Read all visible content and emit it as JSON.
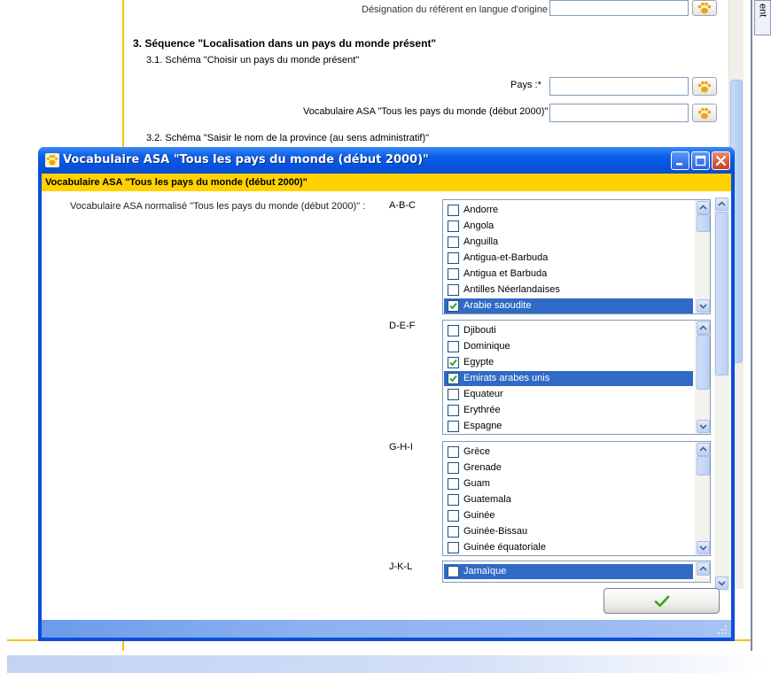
{
  "background_form": {
    "top_label": "Désignation du référent en langue d'origine :",
    "section_title": "3. Séquence \"Localisation dans un pays du monde présent\"",
    "schema_1": "3.1. Schéma \"Choisir un pays du monde présent\"",
    "pays_label": "Pays :*",
    "vocab_label": "Vocabulaire ASA \"Tous les pays du monde (début 2000)\" :*",
    "schema_2": "3.2. Schéma \"Saisir le nom de la province (au sens administratif)\"",
    "side_tab_label": "ent"
  },
  "dialog": {
    "title": "Vocabulaire ASA \"Tous les pays du monde (début 2000)\"",
    "banner": "Vocabulaire ASA \"Tous les pays du monde (début 2000)\"",
    "field_label": "Vocabulaire ASA normalisé \"Tous les pays du monde (début 2000)\" :",
    "groups": [
      {
        "label": "A-B-C",
        "items": [
          {
            "label": "Andorre",
            "checked": false,
            "selected": false
          },
          {
            "label": "Angola",
            "checked": false,
            "selected": false
          },
          {
            "label": "Anguilla",
            "checked": false,
            "selected": false
          },
          {
            "label": "Antigua-et-Barbuda",
            "checked": false,
            "selected": false
          },
          {
            "label": "Antigua et Barbuda",
            "checked": false,
            "selected": false
          },
          {
            "label": "Antilles Néerlandaises",
            "checked": false,
            "selected": false
          },
          {
            "label": "Arabie saoudite",
            "checked": true,
            "selected": true
          }
        ]
      },
      {
        "label": "D-E-F",
        "items": [
          {
            "label": "Djibouti",
            "checked": false,
            "selected": false
          },
          {
            "label": "Dominique",
            "checked": false,
            "selected": false
          },
          {
            "label": "Egypte",
            "checked": true,
            "selected": false
          },
          {
            "label": "Emirats arabes unis",
            "checked": true,
            "selected": true
          },
          {
            "label": "Equateur",
            "checked": false,
            "selected": false
          },
          {
            "label": "Erythrée",
            "checked": false,
            "selected": false
          },
          {
            "label": "Espagne",
            "checked": false,
            "selected": false
          }
        ]
      },
      {
        "label": "G-H-I",
        "items": [
          {
            "label": "Grèce",
            "checked": false,
            "selected": false
          },
          {
            "label": "Grenade",
            "checked": false,
            "selected": false
          },
          {
            "label": "Guam",
            "checked": false,
            "selected": false
          },
          {
            "label": "Guatemala",
            "checked": false,
            "selected": false
          },
          {
            "label": "Guinée",
            "checked": false,
            "selected": false
          },
          {
            "label": "Guinée-Bissau",
            "checked": false,
            "selected": false
          },
          {
            "label": "Guinée équatoriale",
            "checked": false,
            "selected": false
          }
        ]
      },
      {
        "label": "J-K-L",
        "items": [
          {
            "label": "Jamaïque",
            "checked": false,
            "selected": true
          }
        ]
      }
    ],
    "ok_icon": "checkmark-icon"
  },
  "colors": {
    "titlebar_blue": "#0a5ee6",
    "banner_yellow": "#ffd200",
    "selection_blue": "#316ac5",
    "accent_yellow_line": "#f5c400",
    "check_green": "#3aa51f"
  }
}
